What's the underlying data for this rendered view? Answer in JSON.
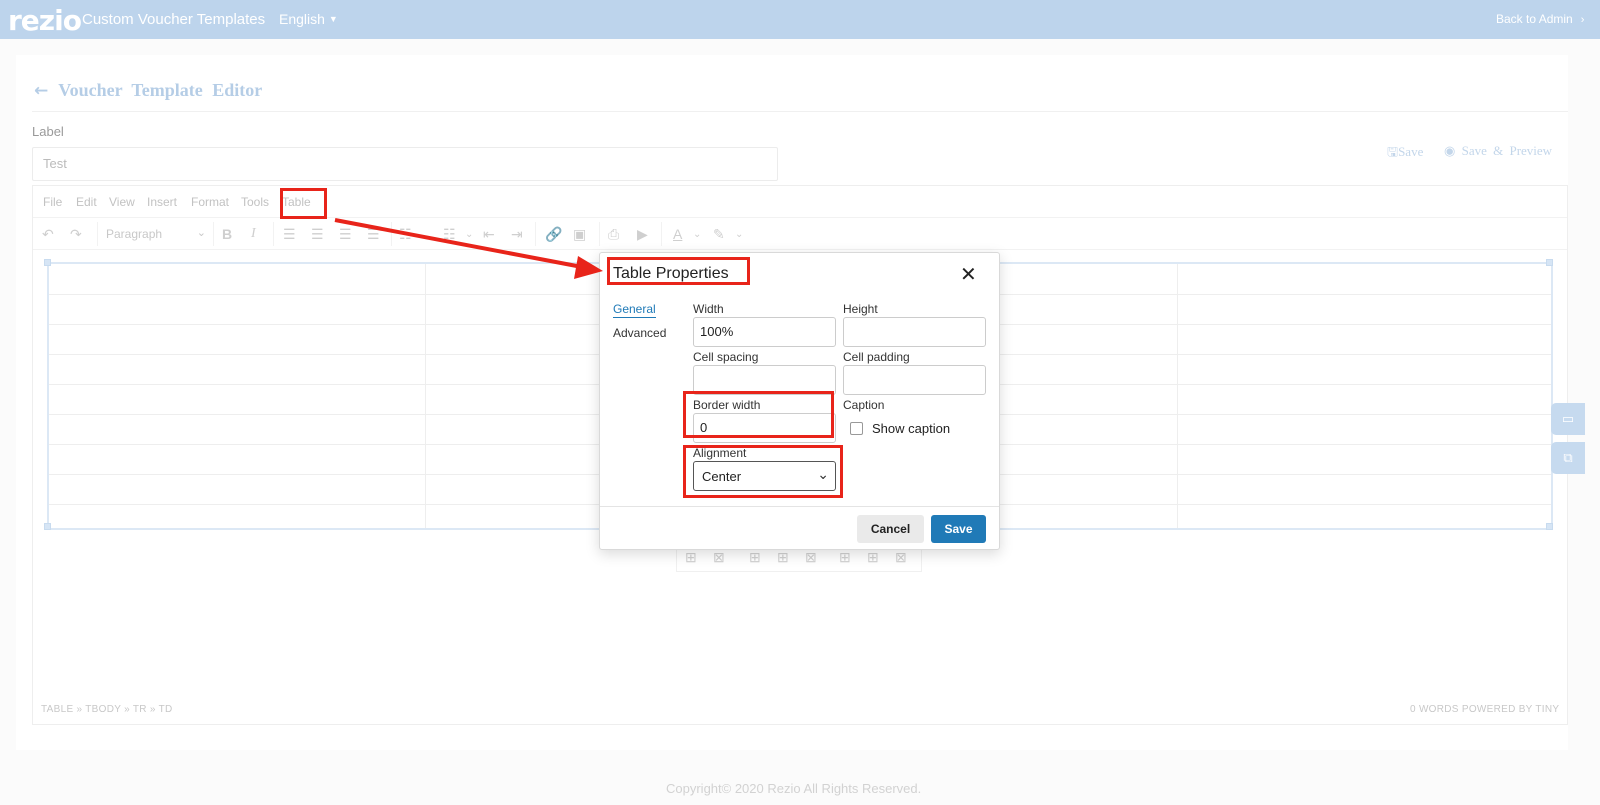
{
  "topbar": {
    "logo": "rezio",
    "title": "Custom Voucher Templates",
    "language": "English",
    "back_to_admin": "Back to Admin"
  },
  "page": {
    "heading": "Voucher Template Editor",
    "label_caption": "Label",
    "label_value": "Test",
    "save": "Save",
    "save_preview": "Save & Preview"
  },
  "editor": {
    "menu": [
      "File",
      "Edit",
      "View",
      "Insert",
      "Format",
      "Tools",
      "Table"
    ],
    "block_format": "Paragraph",
    "status_path": "TABLE » TBODY » TR » TD",
    "status_right": "0 WORDS  POWERED BY TINY"
  },
  "dialog": {
    "title": "Table Properties",
    "tabs": [
      "General",
      "Advanced"
    ],
    "width_label": "Width",
    "width_value": "100%",
    "height_label": "Height",
    "height_value": "",
    "cell_spacing_label": "Cell spacing",
    "cell_spacing_value": "",
    "cell_padding_label": "Cell padding",
    "cell_padding_value": "",
    "border_width_label": "Border width",
    "border_width_value": "0",
    "caption_label": "Caption",
    "show_caption_label": "Show caption",
    "show_caption_checked": false,
    "alignment_label": "Alignment",
    "alignment_value": "Center",
    "cancel": "Cancel",
    "save": "Save"
  },
  "footer": {
    "copyright": "Copyright© 2020 Rezio All Rights Reserved."
  },
  "colors": {
    "topbar": "#bdd4ec",
    "primary_button": "#207ab7",
    "annotation": "#e8241a"
  }
}
